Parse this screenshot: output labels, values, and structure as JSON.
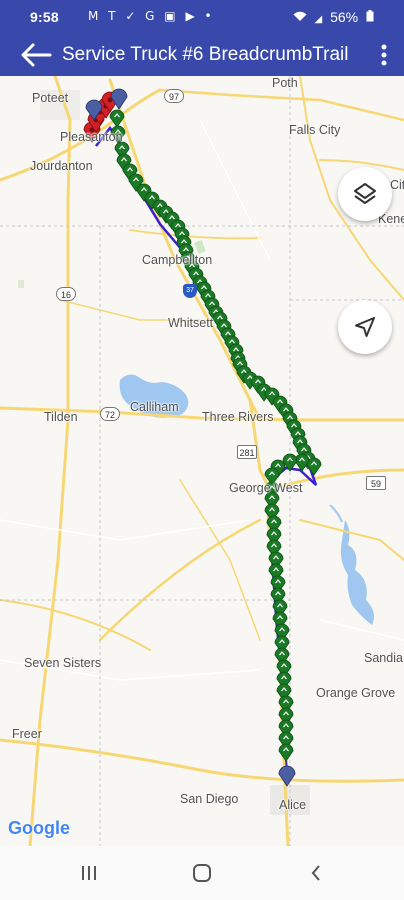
{
  "status_bar": {
    "time": "9:58",
    "notification_icons": "M T ✓ G ▣ ▶ •",
    "signal": "◢",
    "battery_percent": "56%"
  },
  "app_bar": {
    "title": "Service Truck #6 BreadcrumbTrail",
    "back_icon": "arrow-left",
    "menu_icon": "more-vertical"
  },
  "map": {
    "places": {
      "poteet": "Poteet",
      "poth": "Poth",
      "pleasanton": "Pleasanton",
      "falls_city": "Falls City",
      "jourdanton": "Jourdanton",
      "city_partial": "City",
      "kenedy_partial": "Kene",
      "campbellton": "Campbellton",
      "whitsett": "Whitsett",
      "tilden": "Tilden",
      "calliham": "Calliham",
      "three_rivers": "Three Rivers",
      "george_west": "George West",
      "seven_sisters": "Seven Sisters",
      "sandia": "Sandia",
      "orange_grove": "Orange Grove",
      "freer": "Freer",
      "san_diego": "San Diego",
      "alice": "Alice"
    },
    "highway_shields": {
      "hwy_97": "97",
      "hwy_16": "16",
      "hwy_72": "72",
      "hwy_281": "281",
      "hwy_59": "59",
      "i37": "37"
    },
    "layers_icon": "layers",
    "location_icon": "navigation-arrow",
    "attribution": "Google",
    "colors": {
      "route_line": "#3b1fd1",
      "breadcrumb_marker": "#1a7a25",
      "start_marker": "#d31f26",
      "end_marker": "#4a5fa3"
    }
  },
  "nav_bar": {
    "recents_icon": "recents",
    "home_icon": "home",
    "back_icon": "back"
  }
}
